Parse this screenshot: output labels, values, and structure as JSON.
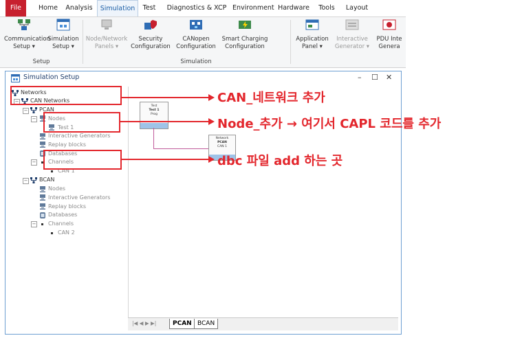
{
  "menubar": {
    "items": [
      "File",
      "Home",
      "Analysis",
      "Simulation",
      "Test",
      "Diagnostics & XCP",
      "Environment",
      "Hardware",
      "Tools",
      "Layout"
    ],
    "active": "Simulation"
  },
  "ribbon": {
    "buttons": [
      {
        "line1": "Communication",
        "line2": "Setup ▾",
        "icon": "communication-setup-icon"
      },
      {
        "line1": "Simulation",
        "line2": "Setup ▾",
        "icon": "simulation-setup-icon"
      },
      {
        "line1": "Node/Network",
        "line2": "Panels ▾",
        "icon": "node-network-panels-icon"
      },
      {
        "line1": "Security",
        "line2": "Configuration",
        "icon": "security-configuration-icon"
      },
      {
        "line1": "CANopen",
        "line2": "Configuration",
        "icon": "canopen-configuration-icon"
      },
      {
        "line1": "Smart Charging",
        "line2": "Configuration",
        "icon": "smart-charging-icon"
      },
      {
        "line1": "Application",
        "line2": "Panel ▾",
        "icon": "application-panel-icon"
      },
      {
        "line1": "Interactive",
        "line2": "Generator ▾",
        "icon": "interactive-generator-icon"
      },
      {
        "line1": "PDU Inte",
        "line2": "Genera",
        "icon": "pdu-generator-icon"
      }
    ],
    "groups": {
      "setup": "Setup",
      "simulation": "Simulation"
    }
  },
  "window": {
    "title": "Simulation Setup",
    "controls": {
      "minimize": "–",
      "maximize": "☐",
      "close": "✕"
    }
  },
  "tree": {
    "networks": "Networks",
    "can_networks": "CAN Networks",
    "pcan": {
      "label": "PCAN",
      "nodes": "Nodes",
      "test1": "Test 1",
      "interactive_generators": "Interactive Generators",
      "replay_blocks": "Replay blocks",
      "databases": "Databases",
      "channels": "Channels",
      "can1": "CAN 1"
    },
    "bcan": {
      "label": "BCAN",
      "nodes": "Nodes",
      "interactive_generators": "Interactive Generators",
      "replay_blocks": "Replay blocks",
      "databases": "Databases",
      "channels": "Channels",
      "can2": "CAN 2"
    }
  },
  "canvas": {
    "node_block": {
      "line1": "Test",
      "line2": "Test 1",
      "line3": "Prog"
    },
    "network_block": {
      "line1": "Network",
      "line2": "PCAN",
      "line3": "CAN 1"
    }
  },
  "tabs": {
    "nav": "|◀  ◀  ▶  ▶|",
    "items": [
      "PCAN",
      "BCAN"
    ],
    "active": "PCAN"
  },
  "annotations": {
    "a1": "CAN_네트워크 추가",
    "a2": "Node_추가 → 여기서 CAPL 코드를 추가",
    "a3": "dbc 파일 add 하는 곳"
  },
  "colors": {
    "annotation": "#e3262c",
    "file_menu": "#c7202e",
    "window_border": "#6e9fd2"
  }
}
